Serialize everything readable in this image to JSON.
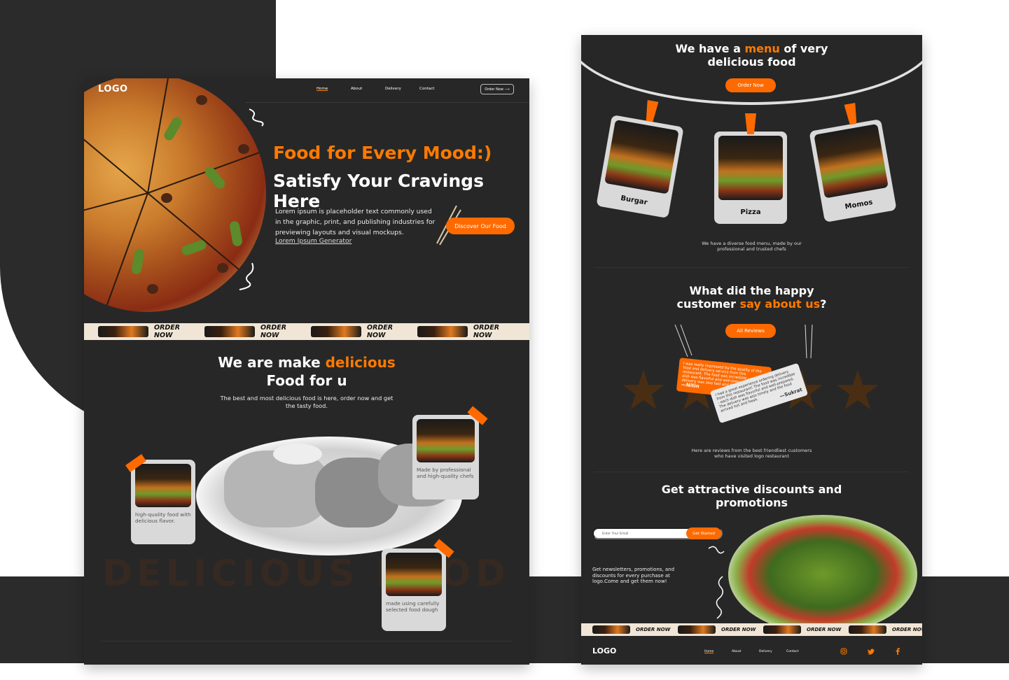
{
  "left": {
    "logo": "LOGO",
    "nav": [
      "Home",
      "About",
      "Delivery",
      "Contact"
    ],
    "nav_button": "Order Now ⟶",
    "hero": {
      "title1": "Food for Every Mood:)",
      "title2": "Satisfy Your Cravings Here",
      "body": "Lorem ipsum is placeholder text commonly used in the graphic, print, and publishing industries for previewing layouts and visual mockups.",
      "link": "Lorem Ipsum Generator",
      "button": "Discover Our Food"
    },
    "ticker_text": "ORDER NOW",
    "section": {
      "title_pre": "We are make ",
      "title_hl": "delicious",
      "title2": "Food for u",
      "subtitle": "The best and most delicious  food is here, order now and get  the tasty food.",
      "watermark": "DELICIOUS FOOD"
    },
    "cards": [
      {
        "text": "high-quality food with delicious flavor."
      },
      {
        "text": "Made by professional and high-quality chefs"
      },
      {
        "text": "made using carefully selected food dough"
      }
    ]
  },
  "right": {
    "menu_title_pre": "We have a ",
    "menu_title_hl": "menu",
    "menu_title_post": " of very",
    "menu_title_line2": "delicious food",
    "order_button": "Order Now",
    "menu_items": [
      "Burgar",
      "Pizza",
      "Momos"
    ],
    "menu_caption": "We have a diverse food menu, made by our professional and trusted chefs",
    "review_title1": "What did the happy",
    "review_title_pre": "customer ",
    "review_title_hl": "say about us",
    "review_title_post": "?",
    "reviews_button": "All Reviews",
    "reviews": [
      {
        "text": "I was really impressed by the quality of the food and delivery service from this restaurant. The food was incredible - each dish was flavorful and well-prepared. The delivery was also fast and the food arrived hot and fresh.",
        "author": "—Nitin"
      },
      {
        "text": "I had a great experience ordering delivery from this restaurant! The food was incredible - each dish was flavorful and well-prepared. The delivery was also timely and the food arrived hot and fresh.",
        "author": "—Sukrat"
      }
    ],
    "reviews_caption": "Here are reviews from the best friendliest customers who have visited logo restaurant",
    "promo_title": "Get attractive discounts and promotions",
    "email_placeholder": "Enter Your Email",
    "email_button": "Get Started",
    "newsletter": "Get newsletters, promotions, and discounts for every purchase at logo.Come and get them now!",
    "ticker_text": "ORDER NOW",
    "footer_logo": "LOGO",
    "footer_nav": [
      "Home",
      "About",
      "Delivery",
      "Contact"
    ],
    "social_icons": [
      "instagram-icon",
      "twitter-icon",
      "facebook-icon"
    ]
  },
  "colors": {
    "accent": "#ff6a00",
    "panel": "#272727",
    "ticker_bg": "#f1e6d6"
  }
}
